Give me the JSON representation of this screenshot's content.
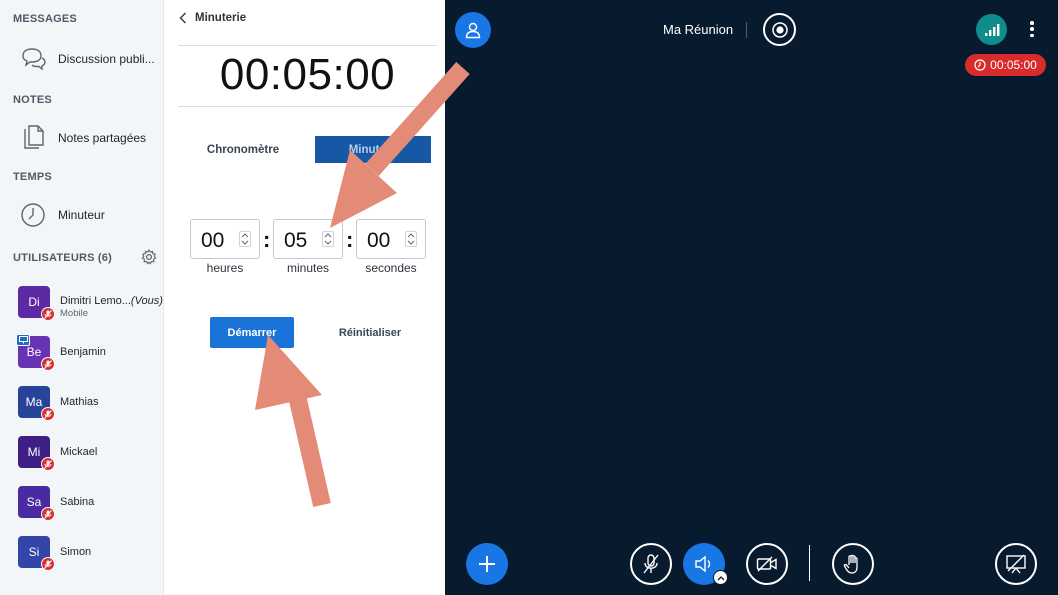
{
  "sidebar": {
    "messages_title": "MESSAGES",
    "public_chat": "Discussion publi...",
    "notes_title": "NOTES",
    "shared_notes": "Notes partagées",
    "time_title": "TEMPS",
    "timer": "Minuteur",
    "users_title": "UTILISATEURS (6)",
    "users": [
      {
        "initials": "Di",
        "name": "Dimitri Lemo...",
        "you": "(Vous)",
        "sub": "Mobile",
        "color": "#5b2aa4"
      },
      {
        "initials": "Be",
        "name": "Benjamin",
        "color": "#6834b4"
      },
      {
        "initials": "Ma",
        "name": "Mathias",
        "color": "#27449a"
      },
      {
        "initials": "Mi",
        "name": "Mickael",
        "color": "#3e1f86"
      },
      {
        "initials": "Sa",
        "name": "Sabina",
        "color": "#4a2aa0"
      },
      {
        "initials": "Si",
        "name": "Simon",
        "color": "#3345a8"
      }
    ]
  },
  "timer_panel": {
    "back_label": "Minuterie",
    "display": "00:05:00",
    "tab_stopwatch": "Chronomètre",
    "tab_timer": "Minuteur",
    "hours": {
      "value": "00",
      "label": "heures"
    },
    "minutes": {
      "value": "05",
      "label": "minutes"
    },
    "seconds": {
      "value": "00",
      "label": "secondes"
    },
    "start_label": "Démarrer",
    "reset_label": "Réinitialiser"
  },
  "meeting": {
    "title": "Ma Réunion",
    "timer_badge": "00:05:00",
    "accent_color": "#1877e4",
    "badge_color": "#d82c2c"
  }
}
